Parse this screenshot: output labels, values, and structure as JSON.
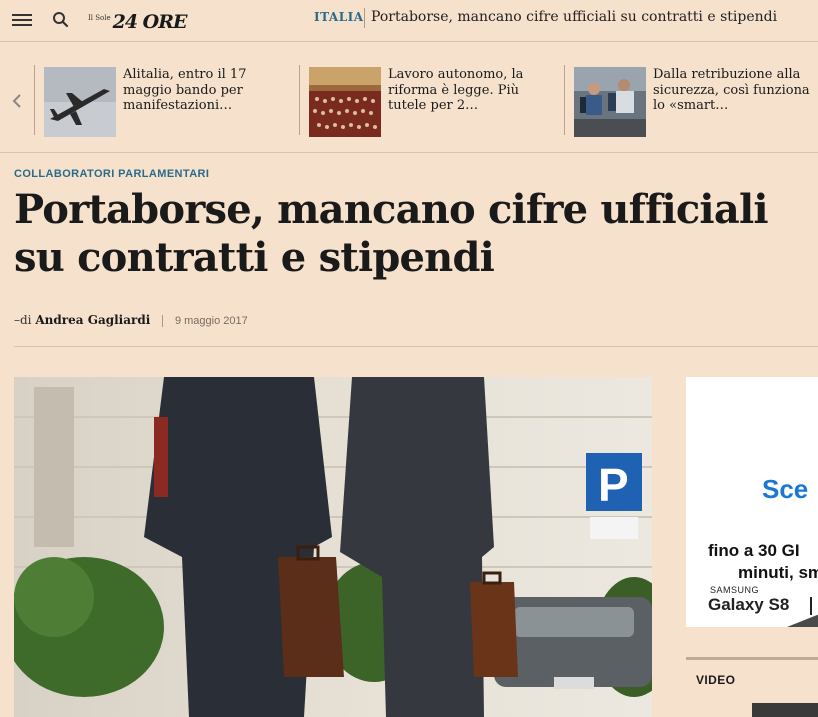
{
  "header": {
    "logo_small": "Il Sole",
    "logo_main": "24 ORE",
    "section": "ITALIA",
    "title": "Portaborse, mancano cifre ufficiali su contratti e stipendi"
  },
  "related": [
    {
      "text": "Alitalia, entro il 17 maggio bando per manifestazioni…",
      "image": "airplane-photo"
    },
    {
      "text": "Lavoro autonomo, la riforma è legge. Più tutele per 2…",
      "image": "parliament-photo"
    },
    {
      "text": "Dalla retribuzione alla sicurezza, così funziona lo «smart…",
      "image": "office-photo"
    }
  ],
  "article": {
    "kicker": "COLLABORATORI PARLAMENTARI",
    "headline": "Portaborse, mancano cifre ufficiali su contratti e stipendi",
    "byline_prefix": "–di",
    "author": "Andrea Gagliardi",
    "date": "9 maggio 2017",
    "image": "two-men-with-briefcases-photo"
  },
  "ad": {
    "brand": "Sce",
    "line1": "fino a 30 GI",
    "line2": "minuti, sm",
    "samsung": "SAMSUNG",
    "product": "Galaxy S8"
  },
  "sidebar": {
    "video_label": "VIDEO"
  },
  "colors": {
    "background": "#f5e1cc",
    "accent": "#2a6b8a",
    "ad_brand": "#1a78d4"
  }
}
